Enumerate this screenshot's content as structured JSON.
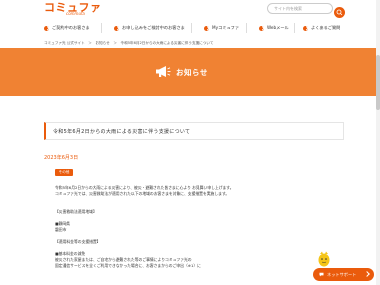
{
  "header": {
    "logo_main": "コミュファ",
    "logo_sub": "commufa",
    "search_placeholder": "サイト内を検索"
  },
  "nav": {
    "items": [
      {
        "label": "ご契約中のお客さま"
      },
      {
        "label": "お申し込みをご検討中のお客さま"
      },
      {
        "label": "Myコミュファ"
      },
      {
        "label": "Webメール"
      },
      {
        "label": "よくあるご質問"
      }
    ]
  },
  "breadcrumb": {
    "text": "コミュファ光 公式サイト　＞　お知らせ　＞　令和5年6月2日からの大雨による災害に伴う支援について"
  },
  "hero": {
    "title": "お知らせ"
  },
  "article": {
    "title": "令和5年6月2日からの大雨による災害に伴う支援について",
    "date": "2023年6月3日",
    "category": "その他",
    "lines": [
      "令和5年6月2日からの大雨による災害により、被災・避難された皆さまに心より お見舞い申し上げます。",
      "コミュファ光では、災害救助法が適用された以下の地域のお客さまを対象に、支援措置を実施します。",
      "",
      "【災害救助法適用地域】",
      "",
      "■静岡県",
      "磐田市",
      "",
      "【適用料金等の支援措置】",
      "",
      "■基本料金の減免",
      "被災された家屋または、ご自宅から避難された等のご事情によりコミュファ光の",
      "固定通信サービスを全くご利用できなかった場合に、お客さまからのご申出（※1）に"
    ]
  },
  "chat": {
    "label": "ネットサポート"
  },
  "colors": {
    "brand": "#ea5b0c",
    "hero_bg": "#f08233"
  }
}
